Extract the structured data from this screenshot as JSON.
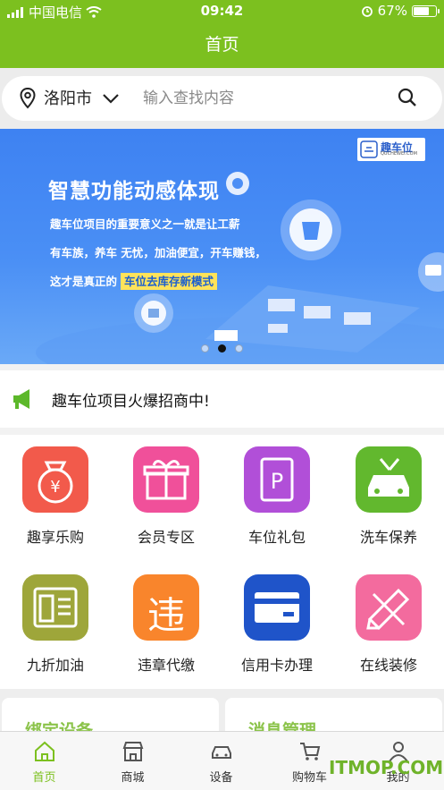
{
  "status_bar": {
    "carrier": "中国电信",
    "time": "09:42",
    "battery": "67%",
    "battery_level": 0.67
  },
  "navbar": {
    "title": "首页"
  },
  "search": {
    "city": "洛阳市",
    "placeholder": "输入查找内容"
  },
  "banner": {
    "title": "智慧功能动感体现",
    "line1": "趣车位项目的重要意义之一就是让工薪",
    "line2": "有车族，养车 无忧，加油便宜，开车赚钱，",
    "line3_prefix": "这才是真正的",
    "line3_highlight": "车位去库存新模式",
    "logo_text": "趣车位",
    "logo_sub": "QUCHEWEI.COM",
    "slide_count": 3,
    "active_slide": 2
  },
  "notice": {
    "text": "趣车位项目火爆招商中!"
  },
  "services": [
    {
      "label": "趣享乐购",
      "icon": "money-bag-icon",
      "color": "#f25a4b"
    },
    {
      "label": "会员专区",
      "icon": "gift-icon",
      "color": "#f0509a"
    },
    {
      "label": "车位礼包",
      "icon": "parking-icon",
      "color": "#b14fd8"
    },
    {
      "label": "洗车保养",
      "icon": "car-wrench-icon",
      "color": "#62b82e"
    },
    {
      "label": "九折加油",
      "icon": "gas-station-icon",
      "color": "#9ea63a"
    },
    {
      "label": "违章代缴",
      "icon": "violation-icon",
      "color": "#f9852c",
      "glyph": "违"
    },
    {
      "label": "信用卡办理",
      "icon": "credit-card-icon",
      "color": "#1f54c9"
    },
    {
      "label": "在线装修",
      "icon": "ruler-pencil-icon",
      "color": "#f36b9e"
    }
  ],
  "cards": [
    {
      "title": "绑定设备"
    },
    {
      "title": "消息管理"
    }
  ],
  "tabs": [
    {
      "label": "首页",
      "icon": "home-icon",
      "active": true
    },
    {
      "label": "商城",
      "icon": "shop-icon",
      "active": false
    },
    {
      "label": "设备",
      "icon": "car-icon",
      "active": false
    },
    {
      "label": "购物车",
      "icon": "cart-icon",
      "active": false
    },
    {
      "label": "我的",
      "icon": "person-icon",
      "active": false
    }
  ],
  "watermark": "ITMOP.COM",
  "colors": {
    "brand_green": "#7cc01f",
    "banner_blue": "#3e82f2"
  }
}
